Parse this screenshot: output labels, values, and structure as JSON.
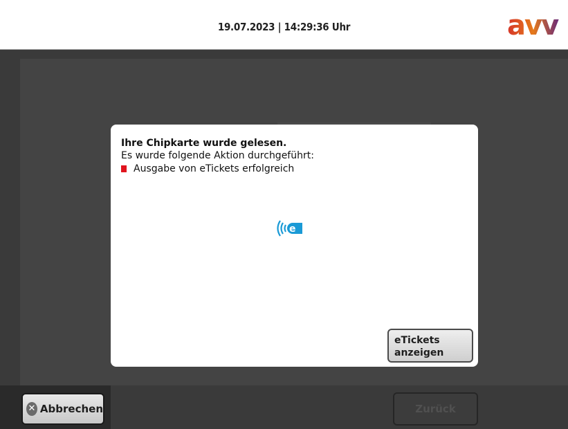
{
  "header": {
    "datetime": "19.07.2023 | 14:29:36 Uhr",
    "logo_text": "avv"
  },
  "modal": {
    "title": "Ihre Chipkarte wurde gelesen.",
    "subtitle": "Es wurde folgende Aktion durchgeführt:",
    "action": "Ausgabe von eTickets erfolgreich",
    "show_button_line1": "eTickets",
    "show_button_line2": "anzeigen"
  },
  "footer": {
    "cancel_label": "Abbrechen",
    "back_label": "Zurück"
  },
  "colors": {
    "accent_red": "#e0141e",
    "eticket_blue": "#1a9ad6"
  },
  "icons": {
    "cancel": "close-circle-icon",
    "eticket": "eticket-contactless-icon"
  }
}
